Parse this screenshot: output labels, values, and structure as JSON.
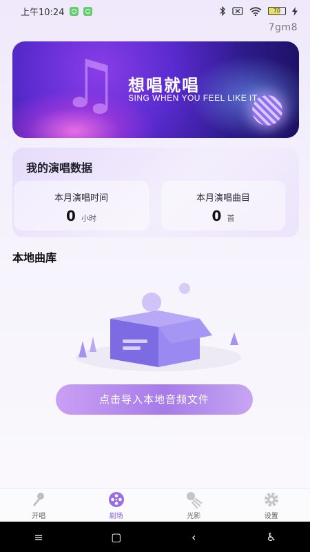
{
  "status_bar": {
    "time": "上午10:24",
    "battery_level": "70",
    "icons": [
      "wechat-notification-icon",
      "wechat-notification-icon",
      "bluetooth-icon",
      "sim-off-icon",
      "wifi-icon",
      "battery-icon",
      "charging-icon"
    ]
  },
  "watermark": "7gm8",
  "banner": {
    "title": "想唱就唱",
    "subtitle": "SING WHEN YOU FEEL LIKE IT"
  },
  "stats": {
    "title": "我的演唱数据",
    "time_label": "本月演唱时间",
    "time_value": "0",
    "time_unit": "小时",
    "songs_label": "本月演唱曲目",
    "songs_value": "0",
    "songs_unit": "首"
  },
  "library": {
    "title": "本地曲库",
    "import_button": "点击导入本地音频文件"
  },
  "tabs": [
    {
      "label": "开唱",
      "icon": "microphone-icon",
      "active": false
    },
    {
      "label": "剧场",
      "icon": "film-reel-icon",
      "active": true
    },
    {
      "label": "光影",
      "icon": "spotlight-icon",
      "active": false
    },
    {
      "label": "设置",
      "icon": "gear-icon",
      "active": false
    }
  ],
  "nav": {
    "menu": "≡",
    "home": "▢",
    "back": "‹",
    "accessibility": "♿"
  },
  "colors": {
    "accent": "#8b5fe0",
    "button_gradient_start": "#c9a0f4",
    "button_gradient_end": "#a77be8"
  }
}
